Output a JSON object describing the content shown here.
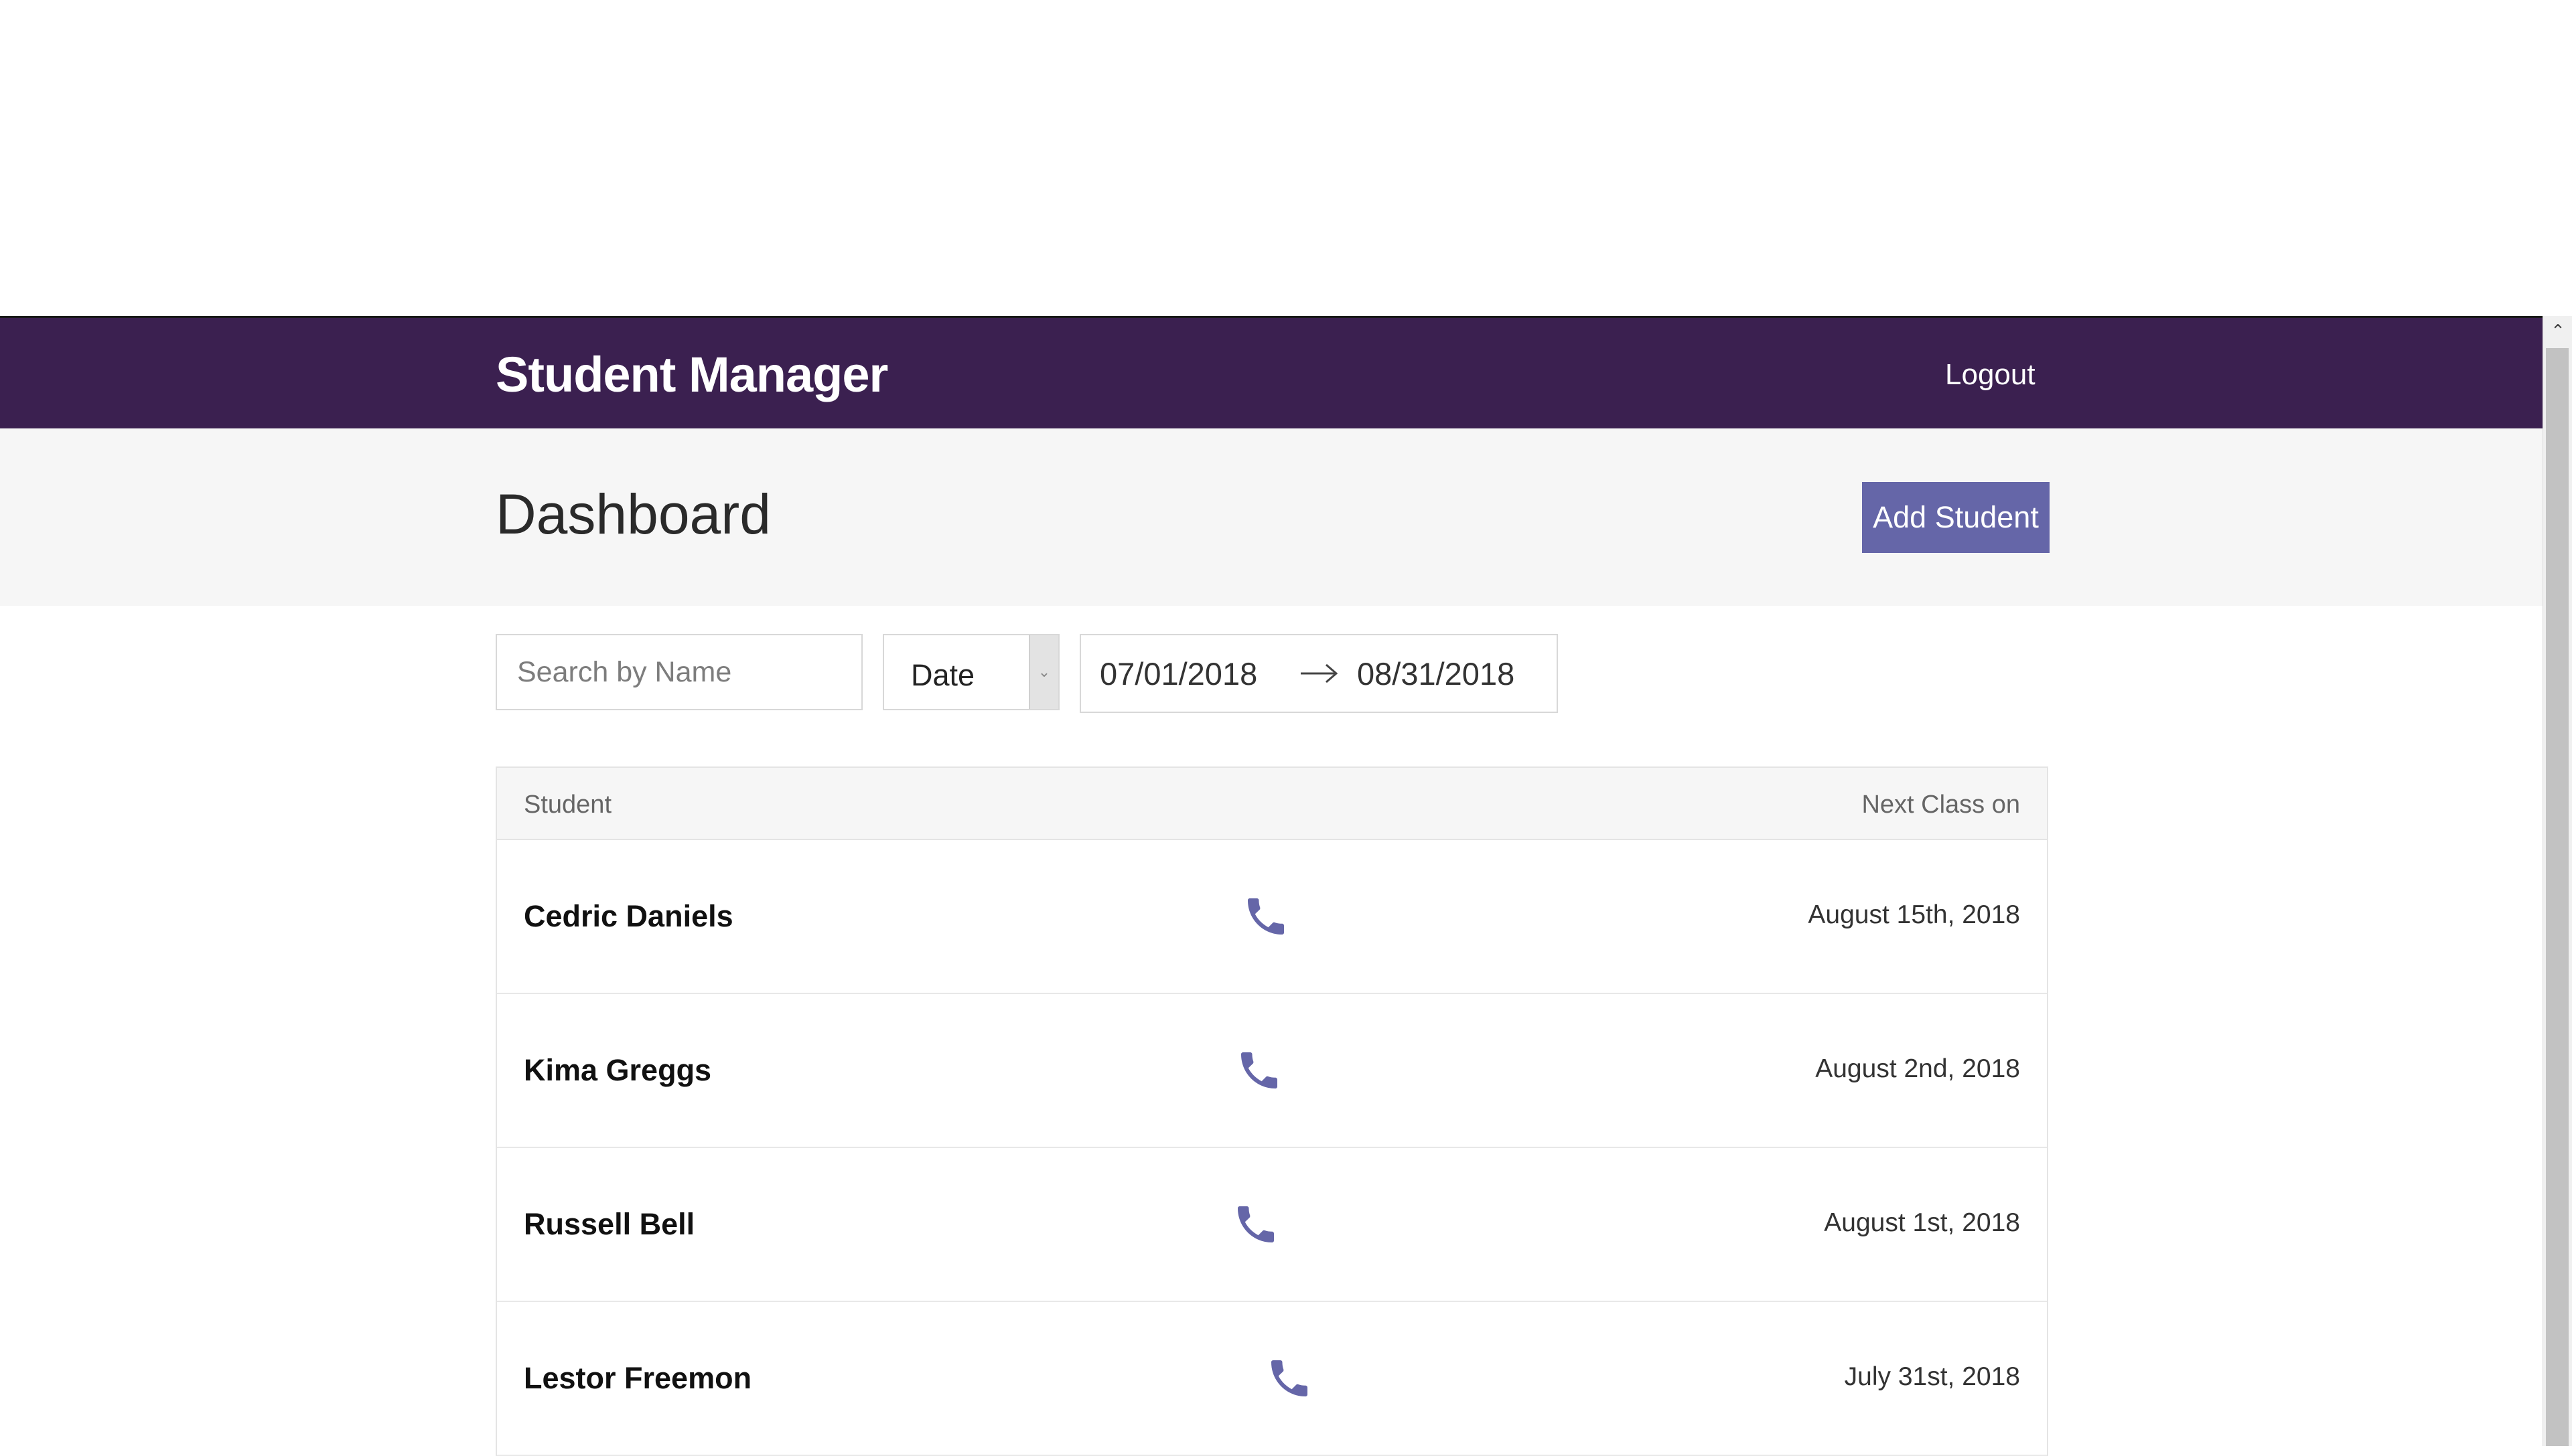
{
  "header": {
    "brand": "Student Manager",
    "logout_label": "Logout"
  },
  "subheader": {
    "title": "Dashboard",
    "add_button_label": "Add Student"
  },
  "filters": {
    "search_placeholder": "Search by Name",
    "sort_selected": "Date",
    "date_from": "07/01/2018",
    "date_to": "08/31/2018"
  },
  "table": {
    "col_student": "Student",
    "col_next_class": "Next Class on",
    "rows": [
      {
        "name": "Cedric Daniels",
        "next_class": "August 15th, 2018"
      },
      {
        "name": "Kima Greggs",
        "next_class": "August 2nd, 2018"
      },
      {
        "name": "Russell Bell",
        "next_class": "August 1st, 2018"
      },
      {
        "name": "Lestor Freemon",
        "next_class": "July 31st, 2018"
      }
    ]
  },
  "colors": {
    "topbar": "#3b2050",
    "accent": "#6566a8",
    "subheader_bg": "#f6f6f6"
  },
  "icons": {
    "phone": "phone-icon",
    "date_arrow": "arrow-right-icon",
    "select_caret": "chevron-down-icon",
    "scroll_up": "chevron-up-icon"
  }
}
